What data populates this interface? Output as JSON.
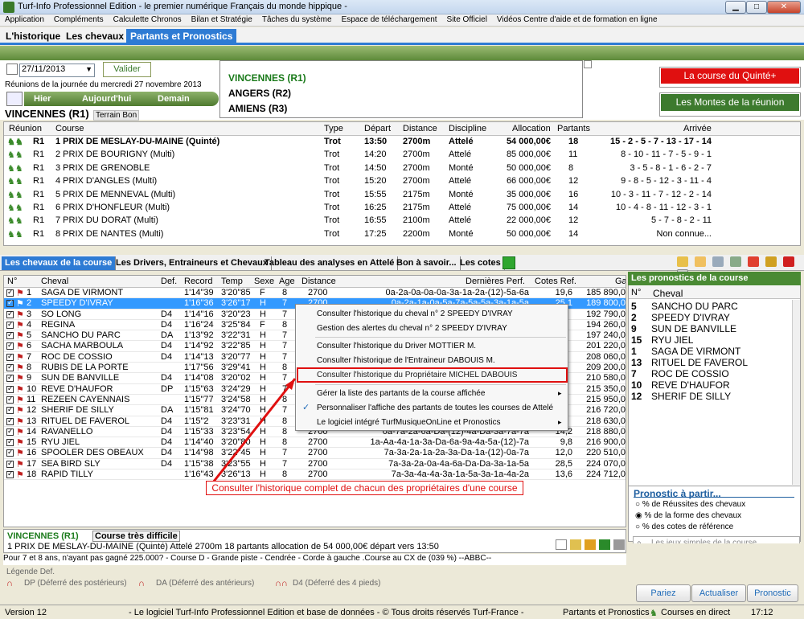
{
  "window": {
    "title": "Turf-Info Professionnel Edition - le premier numérique Français du monde hippique -",
    "minimize": "▁",
    "maximize": "□",
    "close": "✕"
  },
  "menu": [
    "Application",
    "Compléments",
    "Calculette Chronos",
    "Bilan et Stratégie",
    "Tâches du système",
    "Espace de téléchargement",
    "Site Officiel",
    "Vidéos Centre d'aide et de formation en ligne"
  ],
  "main_tabs": {
    "historique": "L'historique",
    "chevaux": "Les chevaux",
    "pronostics": "Partants et Pronostics"
  },
  "date": {
    "value": "27/11/2013",
    "valider": "Valider",
    "reunions_label": "Réunions de la journée du mercredi 27 novembre 2013",
    "hier": "Hier",
    "aujourdhui": "Aujourd'hui",
    "demain": "Demain"
  },
  "reunions": [
    {
      "label": "VINCENNES (R1)",
      "color": "#1a7a1a"
    },
    {
      "label": "ANGERS (R2)",
      "color": "#000000"
    },
    {
      "label": "AMIENS (R3)",
      "color": "#000000"
    }
  ],
  "side_buttons": {
    "quinte": "La course du Quinté+",
    "montes": "Les Montes de la réunion"
  },
  "venue": {
    "name": "VINCENNES (R1)",
    "terrain": "Terrain Bon"
  },
  "race_table": {
    "headers": [
      "Réunion",
      "Course",
      "Type",
      "Départ",
      "Distance",
      "Discipline",
      "Allocation",
      "Partants",
      "Arrivée"
    ],
    "rows": [
      [
        "R1",
        "1 PRIX DE MESLAY-DU-MAINE (Quinté)",
        "Trot",
        "13:50",
        "2700m",
        "Attelé",
        "54 000,00€",
        "18",
        "15 - 2 - 5 - 7 - 13 - 17 - 14"
      ],
      [
        "R1",
        "2 PRIX DE BOURIGNY (Multi)",
        "Trot",
        "14:20",
        "2700m",
        "Attelé",
        "85 000,00€",
        "11",
        "8 - 10 - 11 - 7 - 5 - 9 - 1"
      ],
      [
        "R1",
        "3 PRIX DE GRENOBLE",
        "Trot",
        "14:50",
        "2700m",
        "Monté",
        "50 000,00€",
        "8",
        "3 - 5 - 8 - 1 - 6 - 2 - 7"
      ],
      [
        "R1",
        "4 PRIX D'ANGLES (Multi)",
        "Trot",
        "15:20",
        "2700m",
        "Attelé",
        "66 000,00€",
        "12",
        "9 - 8 - 5 - 12 - 3 - 11 - 4"
      ],
      [
        "R1",
        "5 PRIX DE MENNEVAL (Multi)",
        "Trot",
        "15:55",
        "2175m",
        "Monté",
        "35 000,00€",
        "16",
        "10 - 3 - 11 - 7 - 12 - 2 - 14"
      ],
      [
        "R1",
        "6 PRIX D'HONFLEUR (Multi)",
        "Trot",
        "16:25",
        "2175m",
        "Attelé",
        "75 000,00€",
        "14",
        "10 - 4 - 8 - 11 - 12 - 3 - 1"
      ],
      [
        "R1",
        "7 PRIX DU DORAT (Multi)",
        "Trot",
        "16:55",
        "2100m",
        "Attelé",
        "22 000,00€",
        "12",
        "5 - 7 - 8 - 2 - 11"
      ],
      [
        "R1",
        "8 PRIX DE NANTES (Multi)",
        "Trot",
        "17:25",
        "2200m",
        "Monté",
        "50 000,00€",
        "14",
        "Non connue..."
      ]
    ]
  },
  "content_tabs": [
    "Les chevaux de la course",
    "Les Drivers, Entraineurs et Chevaux",
    "Tableau des analyses en Attelé",
    "Bon à savoir...",
    "Les cotes"
  ],
  "horse_grid": {
    "headers": [
      "N°",
      "Cheval",
      "Def.",
      "Record",
      "Temp",
      "Sexe",
      "Age",
      "Distance",
      "Dernières Perf.",
      "Cotes Ref.",
      "Ga"
    ],
    "rows": [
      [
        "1",
        "SAGA DE VIRMONT",
        "",
        "1'14\"39",
        "3'20\"85",
        "F",
        "8",
        "2700",
        "0a-2a-0a-0a-0a-3a-1a-2a-(12)-5a-6a",
        "19,6",
        "185 890,0"
      ],
      [
        "2",
        "SPEEDY D'IVRAY",
        "",
        "1'16\"36",
        "3'26\"17",
        "H",
        "7",
        "2700",
        "0a-2a-1a-0a-5a-7a-5a-5a-3a-1a-5a",
        "25,1",
        "189 800,0"
      ],
      [
        "3",
        "SO LONG",
        "D4",
        "1'14\"16",
        "3'20\"23",
        "H",
        "7",
        "2700",
        "",
        "",
        "192 790,0"
      ],
      [
        "4",
        "REGINA",
        "D4",
        "1'16\"24",
        "3'25\"84",
        "F",
        "8",
        "2700",
        "",
        "",
        "194 260,0"
      ],
      [
        "5",
        "SANCHO DU PARC",
        "DA",
        "1'13\"92",
        "3'22\"31",
        "H",
        "7",
        "2700",
        "",
        "",
        "197 240,0"
      ],
      [
        "6",
        "SACHA MARBOULA",
        "D4",
        "1'14\"92",
        "3'22\"85",
        "H",
        "7",
        "2700",
        "",
        "",
        "201 220,0"
      ],
      [
        "7",
        "ROC DE COSSIO",
        "D4",
        "1'14\"13",
        "3'20\"77",
        "H",
        "7",
        "2700",
        "",
        "",
        "208 060,0"
      ],
      [
        "8",
        "RUBIS DE LA PORTE",
        "",
        "1'17\"56",
        "3'29\"41",
        "H",
        "8",
        "2700",
        "",
        "",
        "209 200,0"
      ],
      [
        "9",
        "SUN DE BANVILLE",
        "D4",
        "1'14\"08",
        "3'20\"02",
        "H",
        "7",
        "2700",
        "",
        "",
        "210 580,0"
      ],
      [
        "10",
        "REVE D'HAUFOR",
        "DP",
        "1'15\"63",
        "3'24\"29",
        "H",
        "7",
        "2700",
        "",
        "",
        "215 350,0"
      ],
      [
        "11",
        "REZEEN CAYENNAIS",
        "",
        "1'15\"77",
        "3'24\"58",
        "H",
        "8",
        "2700",
        "",
        "",
        "215 950,0"
      ],
      [
        "12",
        "SHERIF DE SILLY",
        "DA",
        "1'15\"81",
        "3'24\"70",
        "H",
        "7",
        "2700",
        "",
        "",
        "216 720,0"
      ],
      [
        "13",
        "RITUEL DE FAVEROL",
        "D4",
        "1'15\"2",
        "3'23\"31",
        "H",
        "8",
        "2700",
        "",
        "",
        "218 630,0"
      ],
      [
        "14",
        "RAVANELLO",
        "D4",
        "1'15\"33",
        "3'23\"54",
        "H",
        "8",
        "2700",
        "0a-7a-2a-6a-Da-(12)-4a-Da-3a-7a-7a",
        "14,2",
        "218 880,0"
      ],
      [
        "15",
        "RYU JIEL",
        "D4",
        "1'14\"40",
        "3'20\"80",
        "H",
        "8",
        "2700",
        "1a-Aa-4a-1a-3a-Da-6a-9a-4a-5a-(12)-7a",
        "9,8",
        "216 900,0"
      ],
      [
        "16",
        "SPOOLER DES OBEAUX",
        "D4",
        "1'14\"98",
        "3'22\"45",
        "H",
        "7",
        "2700",
        "7a-3a-2a-1a-2a-3a-Da-1a-(12)-0a-7a",
        "12,0",
        "220 510,0"
      ],
      [
        "17",
        "SEA BIRD SLY",
        "D4",
        "1'15\"38",
        "3'23\"55",
        "H",
        "7",
        "2700",
        "7a-3a-2a-0a-4a-6a-Da-Da-3a-1a-5a",
        "28,5",
        "224 070,0"
      ],
      [
        "18",
        "RAPID TILLY",
        "",
        "1'16\"43",
        "3'26\"13",
        "H",
        "8",
        "2700",
        "7a-3a-4a-4a-3a-1a-5a-3a-1a-4a-2a",
        "13,6",
        "224 712,0"
      ]
    ]
  },
  "context_menu": {
    "items": [
      "Consulter l'historique du cheval n° 2 SPEEDY D'IVRAY",
      "Gestion des alertes du cheval n° 2 SPEEDY D'IVRAY",
      "Consulter l'historique du Driver MOTTIER M.",
      "Consulter l'historique de l'Entraineur DABOUIS M.",
      "Consulter l'historique du Propriétaire MICHEL DABOUIS",
      "Gérer la liste des partants de la course affichée",
      "Personnaliser l'affiche des partants de toutes les courses de Attelé",
      "Le logiciel intégré TurfMusiqueOnLine et Pronostics"
    ],
    "arrow": "▸",
    "check": "✓"
  },
  "annotation": "Consulter l'historique complet de chacun des propriétaires d'une course",
  "pronostics": {
    "title": "Les pronostics de la course",
    "headers": [
      "N°",
      "Cheval"
    ],
    "rows": [
      [
        "5",
        "SANCHO DU PARC"
      ],
      [
        "2",
        "SPEEDY D'IVRAY"
      ],
      [
        "9",
        "SUN DE BANVILLE"
      ],
      [
        "15",
        "RYU JIEL"
      ],
      [
        "1",
        "SAGA DE VIRMONT"
      ],
      [
        "13",
        "RITUEL DE FAVEROL"
      ],
      [
        "7",
        "ROC DE COSSIO"
      ],
      [
        "10",
        "REVE D'HAUFOR"
      ],
      [
        "12",
        "SHERIF DE SILLY"
      ]
    ]
  },
  "prono_partir": {
    "title": "Pronostic à partir...",
    "options": [
      "% de Réussites des chevaux",
      "% de la forme des chevaux",
      "% des cotes de référence"
    ],
    "selected": 1,
    "search_placeholder": "Les jeux simples de la course"
  },
  "course_info": {
    "venue": "VINCENNES (R1)",
    "difficulty": "Course très difficile",
    "line": "1 PRIX DE MESLAY-DU-MAINE (Quinté) Attelé 2700m 18 partants allocation de 54 000,00€ départ vers 13:50"
  },
  "info_line": "Pour 7 et 8 ans, n'ayant pas gagné 225.000? - Course D - Grande piste - Cendrée - Corde à gauche .Course au CX de (039 %) --ABBC--",
  "legend": {
    "title": "Légende Def.",
    "dp": "DP (Déferré des postérieurs)",
    "da": "DA (Déferré des antérieurs)",
    "d4": "D4 (Déferré des 4 pieds)"
  },
  "buttons": {
    "pariez": "Pariez",
    "actualiser": "Actualiser",
    "pronostic": "Pronostic"
  },
  "status": {
    "version": "Version 12",
    "copyright": "- Le logiciel Turf-Info Professionnel Edition et base de données - © Tous droits réservés Turf-France -",
    "mode": "Partants et Pronostics",
    "live": "Courses en direct",
    "time": "17:12"
  },
  "colors": {
    "green": "#4a8a34",
    "blue": "#2e7bd4",
    "red": "#e01010"
  }
}
